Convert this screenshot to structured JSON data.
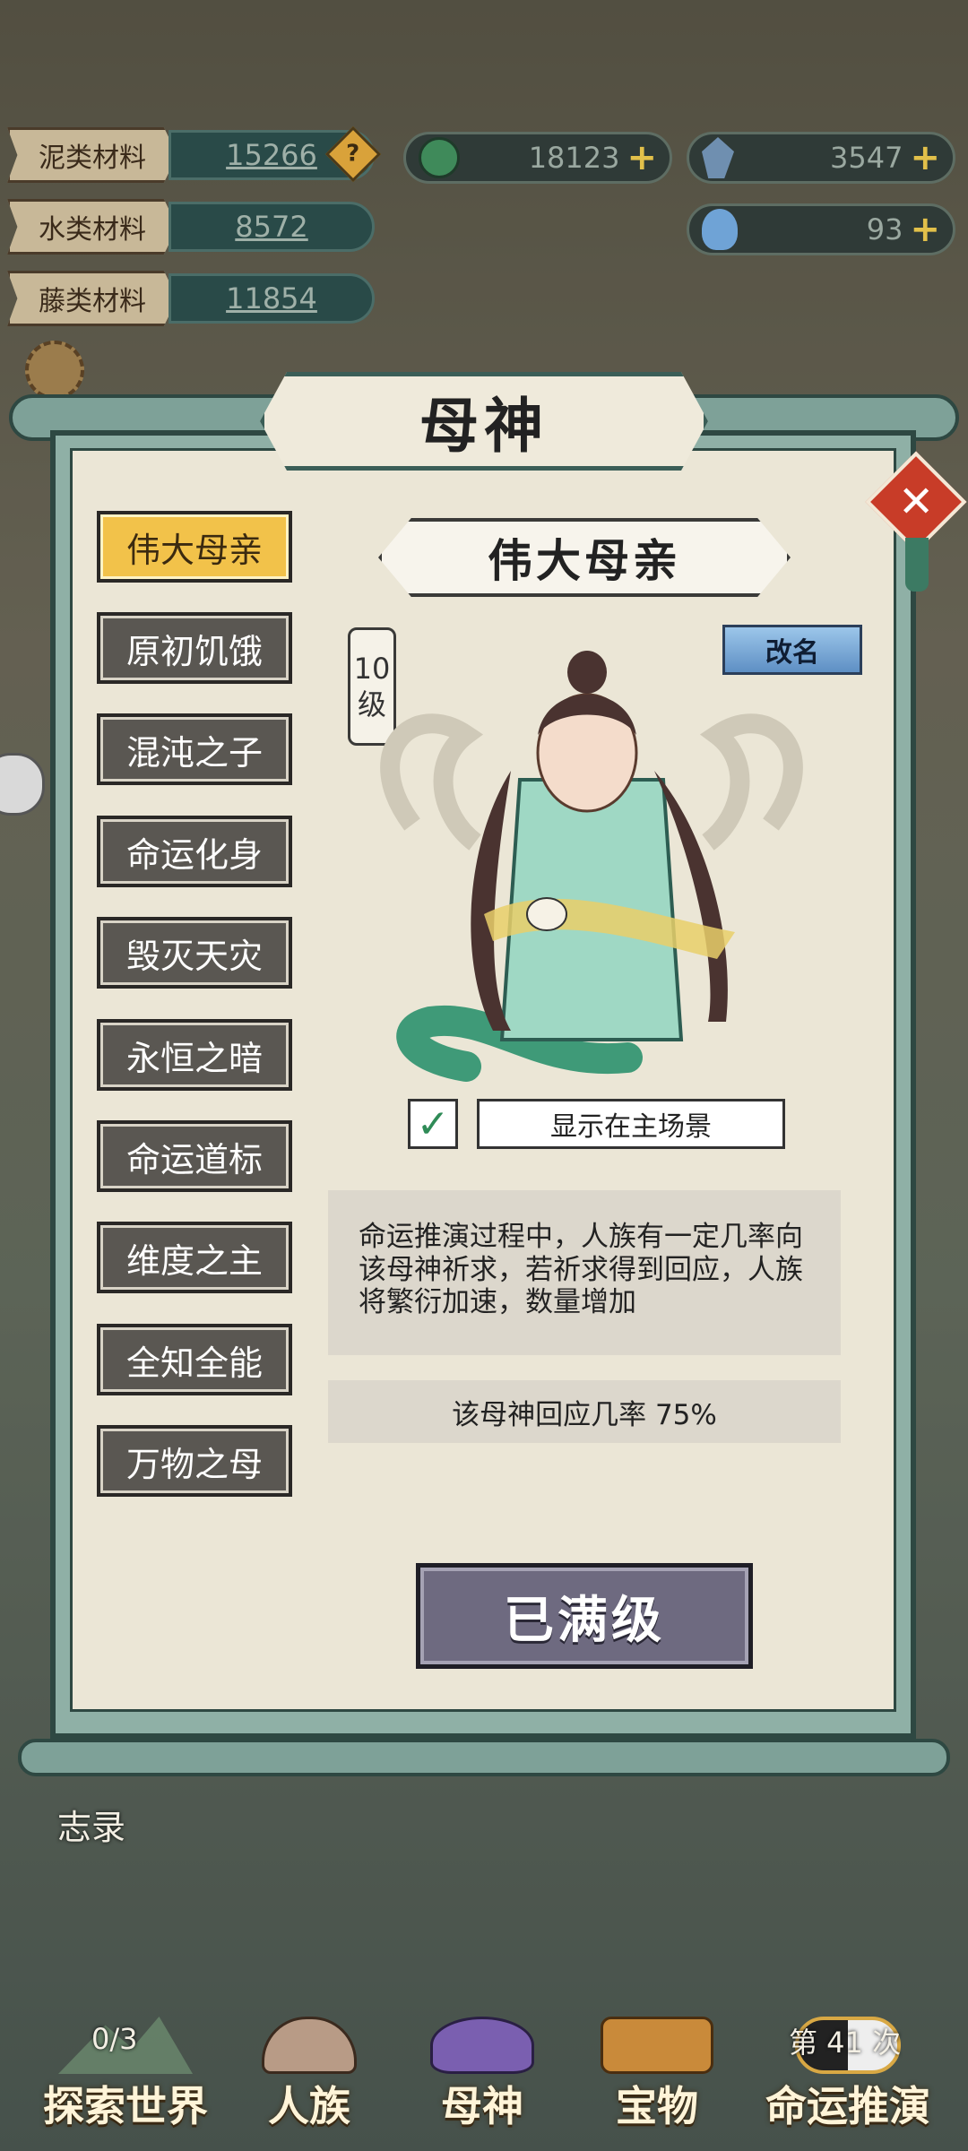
{
  "resources": {
    "materials": [
      {
        "label": "泥类材料",
        "value": "15266"
      },
      {
        "label": "水类材料",
        "value": "8572"
      },
      {
        "label": "藤类材料",
        "value": "11854"
      }
    ],
    "currency_1": "18123",
    "currency_2": "3547",
    "currency_3": "93"
  },
  "modal": {
    "title": "母神",
    "tabs": [
      "伟大母亲",
      "原初饥饿",
      "混沌之子",
      "命运化身",
      "毁灭天灾",
      "永恒之暗",
      "命运道标",
      "维度之主",
      "全知全能",
      "万物之母"
    ],
    "selected_name": "伟大母亲",
    "level_num": "10",
    "level_unit": "级",
    "rename_label": "改名",
    "show_in_scene_label": "显示在主场景",
    "show_in_scene_checked": true,
    "description": "命运推演过程中，人族有一定几率向该母神祈求，若祈求得到回应，人族将繁衍加速，数量增加",
    "response_chance": "该母神回应几率  75%",
    "max_level_label": "已满级"
  },
  "nav": {
    "chronicle_label": "志录",
    "explore_label": "探索世界",
    "explore_progress": "0/3",
    "human_label": "人族",
    "mother_label": "母神",
    "treasure_label": "宝物",
    "fate_label": "命运推演",
    "fate_count": "第 41 次"
  },
  "colors": {
    "accent_gold": "#f2c24a",
    "panel_green": "#7ea198",
    "close_red": "#c83c28"
  }
}
